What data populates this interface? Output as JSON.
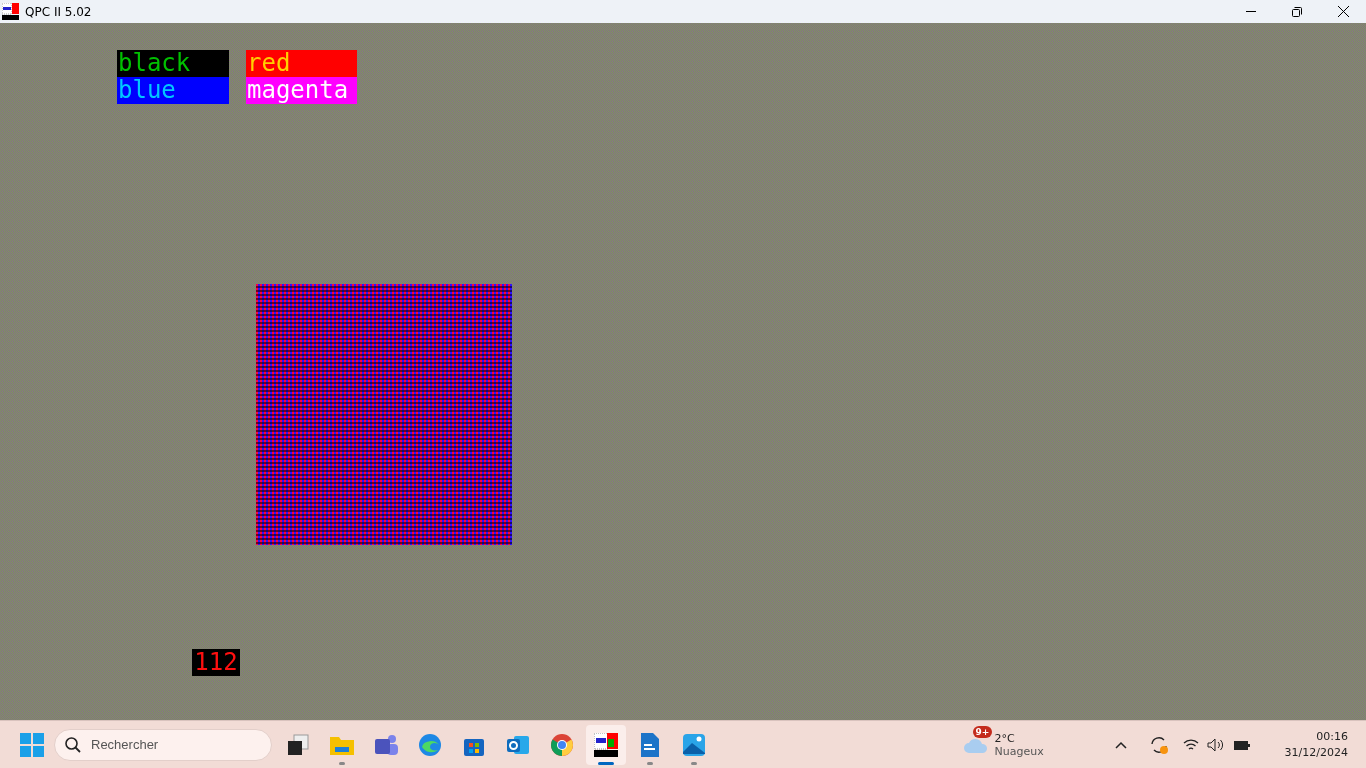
{
  "window": {
    "title": "QPC II 5.02"
  },
  "canvas": {
    "labels": [
      {
        "text": "black",
        "color": "#000000"
      },
      {
        "text": "red",
        "color": "#ff0000"
      },
      {
        "text": "blue",
        "color": "#0000ff"
      },
      {
        "text": "magenta",
        "color": "#ff00ff"
      }
    ],
    "counter": "112"
  },
  "taskbar": {
    "search": {
      "placeholder": "Rechercher"
    },
    "apps": [
      {
        "kind": "taskview",
        "running": false,
        "selected": false
      },
      {
        "kind": "folder",
        "running": true,
        "selected": false
      },
      {
        "kind": "teams",
        "running": false,
        "selected": false
      },
      {
        "kind": "edge",
        "running": false,
        "selected": false
      },
      {
        "kind": "store",
        "running": false,
        "selected": false
      },
      {
        "kind": "outlook",
        "running": false,
        "selected": false
      },
      {
        "kind": "chrome",
        "running": false,
        "selected": false
      },
      {
        "kind": "qpc",
        "running": true,
        "selected": true
      },
      {
        "kind": "writer",
        "running": true,
        "selected": false
      },
      {
        "kind": "photos",
        "running": true,
        "selected": false
      }
    ],
    "weather": {
      "badge": "9+",
      "temperature": "2°C",
      "condition": "Nuageux"
    },
    "time": "00:16",
    "date": "31/12/2024"
  }
}
